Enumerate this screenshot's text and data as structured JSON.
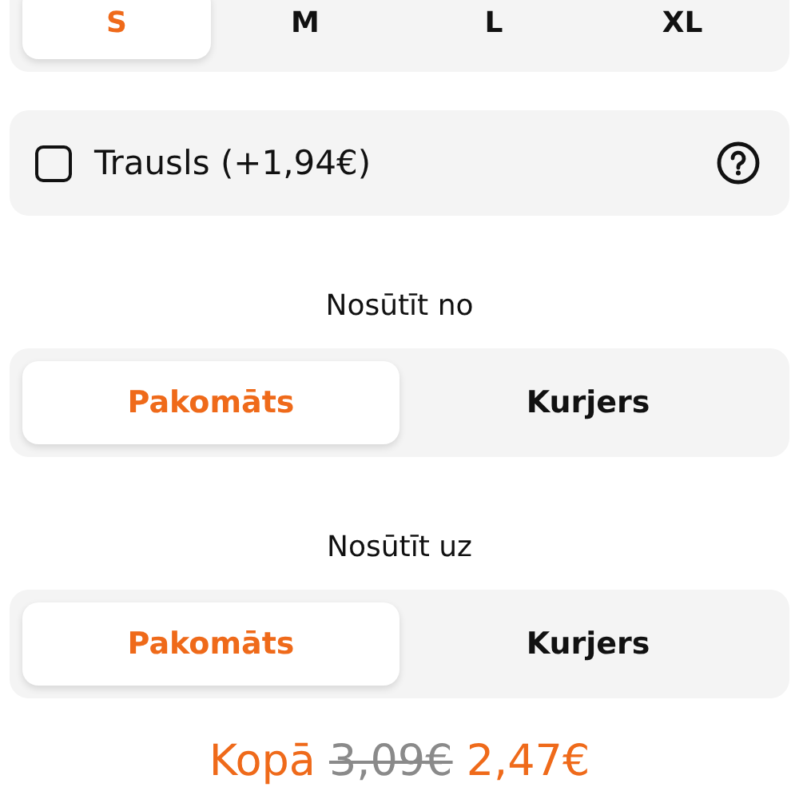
{
  "size_options": [
    {
      "label": "S",
      "selected": true
    },
    {
      "label": "M",
      "selected": false
    },
    {
      "label": "L",
      "selected": false
    },
    {
      "label": "XL",
      "selected": false
    }
  ],
  "fragile": {
    "label": "Trausls (+1,94€)",
    "checked": false
  },
  "send_from": {
    "title": "Nosūtīt no",
    "options": [
      {
        "label": "Pakomāts",
        "selected": true
      },
      {
        "label": "Kurjers",
        "selected": false
      }
    ]
  },
  "send_to": {
    "title": "Nosūtīt uz",
    "options": [
      {
        "label": "Pakomāts",
        "selected": true
      },
      {
        "label": "Kurjers",
        "selected": false
      }
    ]
  },
  "total": {
    "label": "Kopā",
    "old_price": "3,09€",
    "price": "2,47€"
  }
}
